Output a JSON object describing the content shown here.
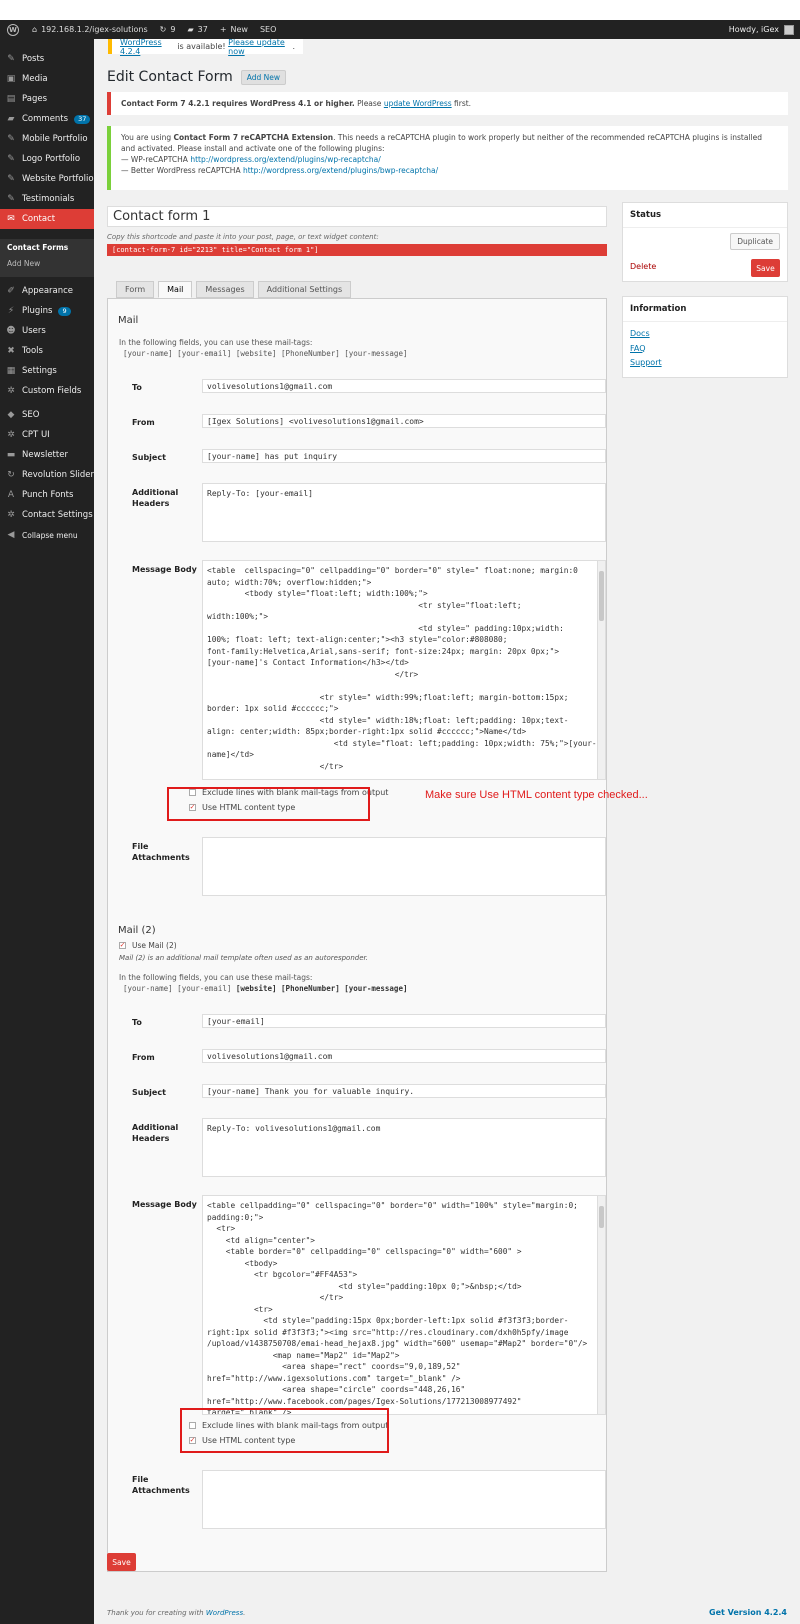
{
  "adminbar": {
    "site": "192.168.1.2/igex-solutions",
    "updates": "9",
    "comments": "37",
    "new": "New",
    "seo": "SEO",
    "howdy": "Howdy, iGex"
  },
  "sidebar": {
    "items": [
      {
        "label": "Posts",
        "icon": "pin-icon"
      },
      {
        "label": "Media",
        "icon": "media-icon"
      },
      {
        "label": "Pages",
        "icon": "pages-icon"
      },
      {
        "label": "Comments",
        "icon": "comment-icon",
        "badge": "37"
      },
      {
        "label": "Mobile Portfolio",
        "icon": "pin-icon"
      },
      {
        "label": "Logo Portfolio",
        "icon": "pin-icon"
      },
      {
        "label": "Website Portfolio",
        "icon": "pin-icon"
      },
      {
        "label": "Testimonials",
        "icon": "pin-icon"
      },
      {
        "label": "Contact",
        "icon": "mail-icon"
      },
      {
        "label": "Appearance",
        "icon": "brush-icon"
      },
      {
        "label": "Plugins",
        "icon": "plug-icon",
        "badge": "9"
      },
      {
        "label": "Users",
        "icon": "user-icon"
      },
      {
        "label": "Tools",
        "icon": "wrench-icon"
      },
      {
        "label": "Settings",
        "icon": "settings-icon"
      },
      {
        "label": "Custom Fields",
        "icon": "gear-icon"
      },
      {
        "label": "SEO",
        "icon": "seo-icon"
      },
      {
        "label": "CPT UI",
        "icon": "gear-icon"
      },
      {
        "label": "Newsletter",
        "icon": "newsletter-icon"
      },
      {
        "label": "Revolution Slider",
        "icon": "refresh-icon"
      },
      {
        "label": "Punch Fonts",
        "icon": "font-icon"
      },
      {
        "label": "Contact Settings",
        "icon": "gear-icon"
      },
      {
        "label": "Collapse menu",
        "icon": "collapse-icon"
      }
    ],
    "submenu": [
      "Contact Forms",
      "Add New"
    ]
  },
  "nag": {
    "link1": "WordPress 4.2.4",
    "text": " is available! ",
    "link2": "Please update now",
    "end": "."
  },
  "page": {
    "title": "Edit Contact Form",
    "add_new": "Add New"
  },
  "notice_red": {
    "bold": "Contact Form 7 4.2.1 requires WordPress 4.1 or higher.",
    "text": " Please ",
    "link": "update WordPress",
    "end": " first."
  },
  "notice_green": {
    "pre": "You are using ",
    "bold": "Contact Form 7 reCAPTCHA Extension",
    "text": ". This needs a reCAPTCHA plugin to work properly but neither of the recommended reCAPTCHA plugins is installed and activated. Please install and activate one of the following plugins:",
    "line1_pre": "— WP-reCAPTCHA ",
    "line1_link": "http://wordpress.org/extend/plugins/wp-recaptcha/",
    "line2_pre": "— Better WordPress reCAPTCHA ",
    "line2_link": "http://wordpress.org/extend/plugins/bwp-recaptcha/"
  },
  "form": {
    "title": "Contact form 1",
    "shortcode_note": "Copy this shortcode and paste it into your post, page, or text widget content:",
    "shortcode": "[contact-form-7 id=\"2213\" title=\"Contact form 1\"]",
    "tabs": [
      "Form",
      "Mail",
      "Messages",
      "Additional Settings"
    ]
  },
  "mail": {
    "heading": "Mail",
    "help": "In the following fields, you can use these mail-tags:",
    "tags": "[your-name] [your-email] [website] [PhoneNumber] [your-message]",
    "labels": {
      "to": "To",
      "from": "From",
      "subject": "Subject",
      "headers": "Additional Headers",
      "body": "Message Body",
      "attachments": "File Attachments"
    },
    "to": "volivesolutions1@gmail.com",
    "from": "[Igex Solutions] <volivesolutions1@gmail.com>",
    "subject": "[your-name] has put inquiry",
    "headers": "Reply-To: [your-email]",
    "body": "<table  cellspacing=\"0\" cellpadding=\"0\" border=\"0\" style=\" float:none; margin:0\nauto; width:70%; overflow:hidden;\">\n        <tbody style=\"float:left; width:100%;\">\n                                             <tr style=\"float:left;\nwidth:100%;\">\n                                             <td style=\" padding:10px;width:\n100%; float: left; text-align:center;\"><h3 style=\"color:#808080;\nfont-family:Helvetica,Arial,sans-serif; font-size:24px; margin: 20px 0px;\">\n[your-name]'s Contact Information</h3></td>\n                                        </tr>\n\n                        <tr style=\" width:99%;float:left; margin-bottom:15px;\nborder: 1px solid #cccccc;\">\n                        <td style=\" width:18%;float: left;padding: 10px;text-\nalign: center;width: 85px;border-right:1px solid #cccccc;\">Name</td>\n                           <td style=\"float: left;padding: 10px;width: 75%;\">[your-\nname]</td>\n                        </tr>",
    "exclude": "Exclude lines with blank mail-tags from output",
    "use_html": "Use HTML content type",
    "annotation": "Make sure Use HTML content type checked..."
  },
  "mail2": {
    "heading": "Mail (2)",
    "use": "Use Mail (2)",
    "note": "Mail (2) is an additional mail template often used as an autoresponder.",
    "help": "In the following fields, you can use these mail-tags:",
    "tags_plain": "[your-name] [your-email] ",
    "tags_bold": "[website] [PhoneNumber] [your-message]",
    "to": "[your-email]",
    "from": "volivesolutions1@gmail.com",
    "subject": "[your-name] Thank you for valuable inquiry.",
    "headers": "Reply-To: volivesolutions1@gmail.com",
    "body": "<table cellpadding=\"0\" cellspacing=\"0\" border=\"0\" width=\"100%\" style=\"margin:0;\npadding:0;\">\n  <tr>\n    <td align=\"center\">\n    <table border=\"0\" cellpadding=\"0\" cellspacing=\"0\" width=\"600\" >\n        <tbody>\n          <tr bgcolor=\"#FF4A53\">\n                            <td style=\"padding:10px 0;\">&nbsp;</td>\n                        </tr>\n          <tr>\n            <td style=\"padding:15px 0px;border-left:1px solid #f3f3f3;border-\nright:1px solid #f3f3f3;\"><img src=\"http://res.cloudinary.com/dxh0h5pfy/image\n/upload/v1438750708/emai-head_hejax8.jpg\" width=\"600\" usemap=\"#Map2\" border=\"0\"/>\n              <map name=\"Map2\" id=\"Map2\">\n                <area shape=\"rect\" coords=\"9,0,189,52\"\nhref=\"http://www.igexsolutions.com\" target=\"_blank\" />\n                <area shape=\"circle\" coords=\"448,26,16\"\nhref=\"http://www.facebook.com/pages/Igex-Solutions/177213008977492\"\ntarget=\"_blank\" />",
    "exclude": "Exclude lines with blank mail-tags from output",
    "use_html": "Use HTML content type"
  },
  "save_label": "Save",
  "status_box": {
    "title": "Status",
    "duplicate": "Duplicate",
    "delete": "Delete",
    "save": "Save"
  },
  "info_box": {
    "title": "Information",
    "links": [
      "Docs",
      "FAQ",
      "Support"
    ]
  },
  "footer": {
    "thanks": "Thank you for creating with ",
    "link": "WordPress",
    "end": ".",
    "version": "Get Version 4.2.4"
  }
}
